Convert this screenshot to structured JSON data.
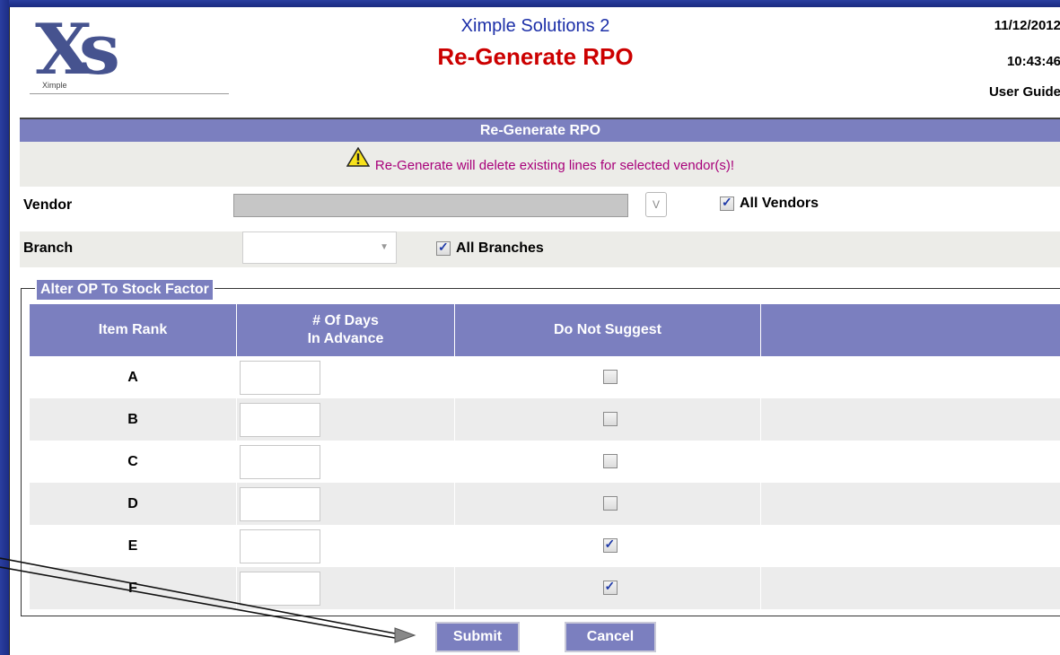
{
  "header": {
    "logo_text": "Xs",
    "logo_small": "Ximple",
    "app_title": "Ximple Solutions 2",
    "page_title": "Re-Generate RPO",
    "date": "11/12/2012",
    "time": "10:43:46",
    "user_guide": "User Guide"
  },
  "section": {
    "title": "Re-Generate RPO",
    "warning": "Re-Generate will delete existing lines for selected vendor(s)!"
  },
  "vendor": {
    "label": "Vendor",
    "lookup_button": "V",
    "all_vendors_label": "All Vendors",
    "all_vendors_checked": true
  },
  "branch": {
    "label": "Branch",
    "all_branches_label": "All Branches",
    "all_branches_checked": true
  },
  "factor": {
    "legend": "Alter OP To Stock Factor",
    "headers": [
      "Item Rank",
      "# Of Days",
      "In Advance",
      "Do Not Suggest"
    ],
    "rows": [
      {
        "rank": "A",
        "checked": false
      },
      {
        "rank": "B",
        "checked": false
      },
      {
        "rank": "C",
        "checked": false
      },
      {
        "rank": "D",
        "checked": false
      },
      {
        "rank": "E",
        "checked": true
      },
      {
        "rank": "F",
        "checked": true
      }
    ]
  },
  "buttons": {
    "submit": "Submit",
    "cancel": "Cancel"
  },
  "colors": {
    "accent": "#7b7fbf",
    "title_red": "#cc0000",
    "app_blue": "#1c2fa8",
    "warning_text": "#a8007a"
  }
}
